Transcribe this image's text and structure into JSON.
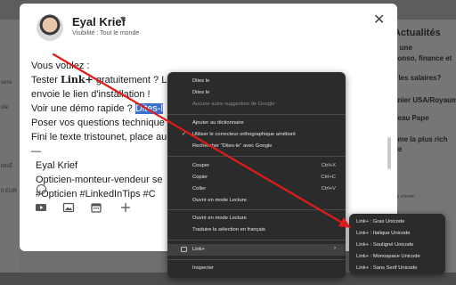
{
  "background": {
    "left_texts": [
      "sens",
      "ole",
      "ntisÉ",
      "0 EUR"
    ],
    "right_title": "Actualités",
    "right_news": [
      {
        "title": "e une",
        "sub": ""
      },
      {
        "title": "conso, finance et",
        "sub": ""
      },
      {
        "title": "r les salaires?",
        "sub": ""
      },
      {
        "title": "anier USA/Royaum",
        "sub": ""
      },
      {
        "title": "veau Pape",
        "sub": ""
      },
      {
        "title": "eme la plus rich",
        "sub": ""
      },
      {
        "title": "de",
        "sub": ""
      },
      {
        "title": "",
        "sub": "i le chemin"
      },
      {
        "title": "",
        "sub": "de"
      },
      {
        "title": "",
        "sub": "16"
      }
    ]
  },
  "composer": {
    "author_name": "Eyal Krief",
    "visibility": "Visibilité : Tout le monde",
    "close_icon": "close-icon",
    "text_lines": [
      {
        "pre": "Vous voulez :",
        "bold": "",
        "post": "",
        "sel": ""
      },
      {
        "pre": "Tester ",
        "bold": "Link+",
        "post": " gratuitement ? La",
        "sel": ""
      },
      {
        "pre": "envoie le lien d'installation !",
        "bold": "",
        "post": "",
        "sel": ""
      },
      {
        "pre": "Voir une démo rapide ? ",
        "bold": "",
        "post": "",
        "sel": "Dites-l"
      },
      {
        "pre": "Poser vos questions technique",
        "bold": "",
        "post": "",
        "sel": ""
      },
      {
        "pre": "Fini le texte tristounet, place au",
        "bold": "",
        "post": "",
        "sel": ""
      },
      {
        "pre": "—",
        "bold": "",
        "post": "",
        "sel": ""
      },
      {
        "pre": "Eyal Krief",
        "bold": "",
        "post": "",
        "sel": ""
      },
      {
        "pre": "Opticien-monteur-vendeur se",
        "bold": "",
        "post": "",
        "sel": ""
      },
      {
        "pre": "#Opticien #LinkedInTips #C",
        "bold": "",
        "post": "",
        "sel": ""
      }
    ],
    "toolbar_icons": [
      "video-icon",
      "image-icon",
      "calendar-icon",
      "plus-icon"
    ]
  },
  "context_menu": {
    "items": [
      {
        "label": "Dites le",
        "shortcut": "",
        "disabled": false
      },
      {
        "label": "Dites le",
        "shortcut": "",
        "disabled": false
      },
      {
        "label": "Aucune autre suggestion de Google",
        "shortcut": "",
        "disabled": true
      },
      {
        "label": "Ajouter au dictionnaire",
        "shortcut": "",
        "disabled": false
      },
      {
        "label": "Utiliser le correcteur orthographique amélioré",
        "shortcut": "",
        "disabled": false,
        "checked": true
      },
      {
        "label": "Rechercher \"Dites-le\" avec Google",
        "shortcut": "",
        "disabled": false
      },
      {
        "label": "Couper",
        "shortcut": "Ctrl+X",
        "disabled": false
      },
      {
        "label": "Copier",
        "shortcut": "Ctrl+C",
        "disabled": false
      },
      {
        "label": "Coller",
        "shortcut": "Ctrl+V",
        "disabled": false
      },
      {
        "label": "Ouvrir en mode Lecture",
        "shortcut": "",
        "disabled": false
      },
      {
        "label": "Ouvrir en mode Lecture",
        "shortcut": "",
        "disabled": false
      },
      {
        "label": "Traduire la sélection en français",
        "shortcut": "",
        "disabled": false
      },
      {
        "label": "Link+",
        "shortcut": "",
        "disabled": false,
        "submenu": true
      },
      {
        "label": "Inspecter",
        "shortcut": "",
        "disabled": false
      }
    ]
  },
  "submenu": {
    "items": [
      {
        "label": "Link+ : Gras Unicode"
      },
      {
        "label": "Link+ : Italique Unicode"
      },
      {
        "label": "Link+ : Souligné Unicode"
      },
      {
        "label": "Link+ : Monospace Unicode"
      },
      {
        "label": "Link+ : Sans Serif Unicode"
      }
    ]
  },
  "colors": {
    "annotation_arrow": "#e01b1b",
    "selection": "#3b6fce",
    "menu_bg": "#2b2b2b"
  }
}
